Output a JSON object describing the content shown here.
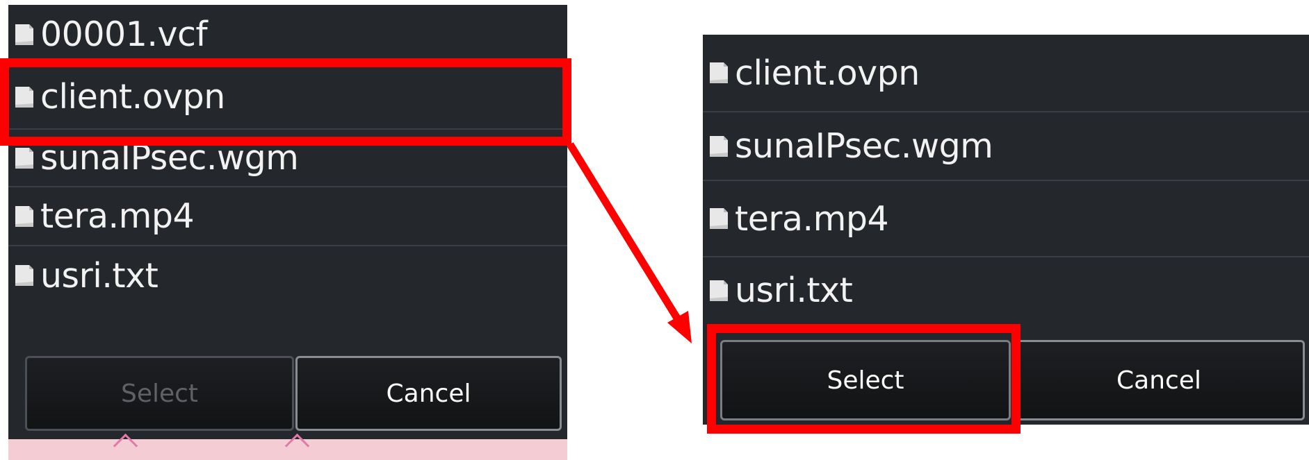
{
  "before_dialog": {
    "files": [
      {
        "name": "00001.vcf",
        "icon": "file-icon"
      },
      {
        "name": "client.ovpn",
        "icon": "file-icon"
      },
      {
        "name": "sunaIPsec.wgm",
        "icon": "file-icon"
      },
      {
        "name": "tera.mp4",
        "icon": "file-icon"
      },
      {
        "name": "usri.txt",
        "icon": "file-icon"
      }
    ],
    "select_label": "Select",
    "select_enabled": false,
    "cancel_label": "Cancel",
    "highlighted_item": "client.ovpn"
  },
  "after_dialog": {
    "files": [
      {
        "name": "client.ovpn",
        "icon": "file-icon"
      },
      {
        "name": "sunaIPsec.wgm",
        "icon": "file-icon"
      },
      {
        "name": "tera.mp4",
        "icon": "file-icon"
      },
      {
        "name": "usri.txt",
        "icon": "file-icon"
      }
    ],
    "select_label": "Select",
    "select_enabled": true,
    "cancel_label": "Cancel",
    "highlighted_button": "Select"
  },
  "colors": {
    "panel_bg": "#24272c",
    "divider": "#3a3e45",
    "text": "#f2f2f2",
    "disabled_text": "#5e6166",
    "highlight": "#ff0000",
    "bottom_strip": "#f3ccd4"
  }
}
